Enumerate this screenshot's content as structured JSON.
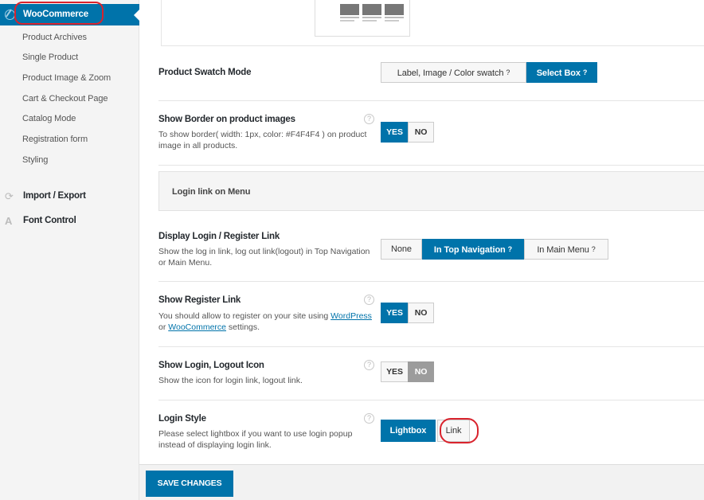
{
  "sidebar": {
    "active_label": "WooCommerce",
    "sub_items": [
      {
        "label": "Product Archives"
      },
      {
        "label": "Single Product"
      },
      {
        "label": "Product Image & Zoom"
      },
      {
        "label": "Cart & Checkout Page"
      },
      {
        "label": "Catalog Mode"
      },
      {
        "label": "Registration form"
      },
      {
        "label": "Styling"
      }
    ],
    "import_export": "Import / Export",
    "font_control": "Font Control"
  },
  "settings": {
    "swatch": {
      "title": "Product Swatch Mode",
      "options": [
        "Label, Image / Color swatch",
        "Select Box"
      ],
      "selected": "Select Box"
    },
    "border": {
      "title": "Show Border on product images",
      "desc": "To show border( width: 1px, color: #F4F4F4 ) on product image in all products.",
      "yes": "YES",
      "no": "NO",
      "selected": "YES"
    },
    "section_label": "Login link on Menu",
    "login_link": {
      "title": "Display Login / Register Link",
      "desc": "Show the log in link, log out link(logout) in Top Navigation or Main Menu.",
      "options": [
        "None",
        "In Top Navigation",
        "In Main Menu"
      ],
      "selected": "In Top Navigation"
    },
    "register": {
      "title": "Show Register Link",
      "desc_pre": "You should allow to register on your site using ",
      "link1": "WordPress",
      "desc_mid": " or ",
      "link2": "WooCommerce",
      "desc_post": " settings.",
      "yes": "YES",
      "no": "NO",
      "selected": "YES"
    },
    "icon": {
      "title": "Show Login, Logout Icon",
      "desc": "Show the icon for login link, logout link.",
      "yes": "YES",
      "no": "NO",
      "selected": "NO"
    },
    "style": {
      "title": "Login Style",
      "desc": "Please select lightbox if you want to use login popup instead of displaying login link.",
      "options": [
        "Lightbox",
        "Link"
      ],
      "selected": "Lightbox"
    }
  },
  "footer": {
    "save_label": "SAVE CHANGES"
  },
  "colors": {
    "accent": "#0073aa",
    "annotation": "#d9232d"
  },
  "icons": {
    "help": "?",
    "help_small": "?"
  }
}
